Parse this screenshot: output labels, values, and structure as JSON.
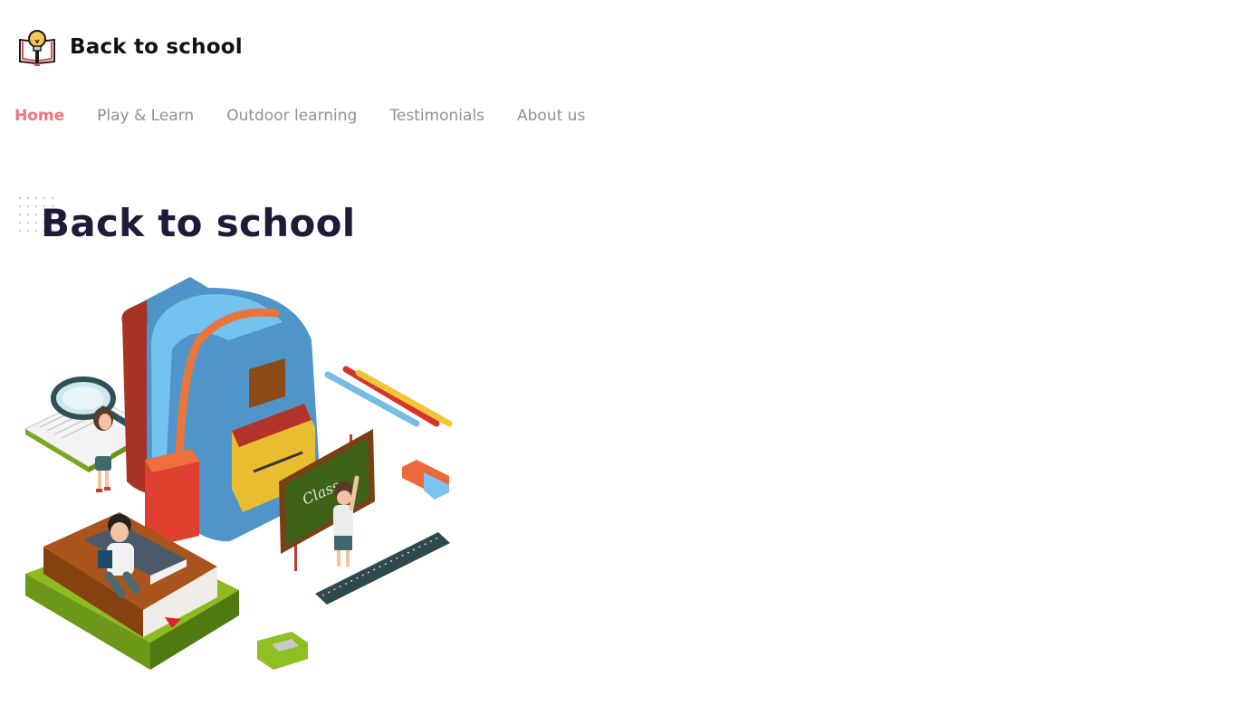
{
  "brand": {
    "title": "Back to school",
    "logo_icon": "book-lightbulb-icon"
  },
  "nav": {
    "items": [
      {
        "label": "Home",
        "active": true
      },
      {
        "label": "Play & Learn",
        "active": false
      },
      {
        "label": "Outdoor learning",
        "active": false
      },
      {
        "label": "Testimonials",
        "active": false
      },
      {
        "label": "About us",
        "active": false
      }
    ]
  },
  "hero": {
    "title": "Back to school",
    "chalkboard_text": "Class",
    "illustration": "school-supplies-illustration"
  },
  "colors": {
    "accent": "#f27379",
    "nav_text": "#8f8f99",
    "hero_title": "#1f1a38",
    "brand_title": "#111111"
  }
}
